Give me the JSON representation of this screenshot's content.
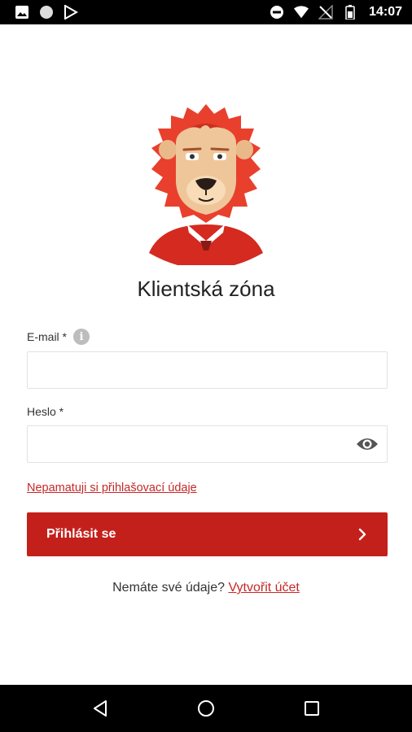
{
  "status_bar": {
    "time": "14:07",
    "left_icons": [
      "image-icon",
      "circle-icon",
      "play-store-icon"
    ],
    "right_icons": [
      "do-not-disturb-icon",
      "wifi-icon",
      "no-signal-icon",
      "battery-icon"
    ]
  },
  "header": {
    "title": "Klientská zóna",
    "mascot_icon": "lion-mascot"
  },
  "form": {
    "email_label": "E-mail *",
    "email_info_icon": "info-icon",
    "email_value": "",
    "email_placeholder": "",
    "password_label": "Heslo *",
    "password_value": "",
    "password_placeholder": "",
    "password_toggle_icon": "eye-icon",
    "forgot_link": "Nepamatuji si přihlašovací údaje",
    "login_button_label": "Přihlásit se",
    "login_button_icon": "chevron-right-icon"
  },
  "signup": {
    "prompt": "Nemáte své údaje?",
    "link": "Vytvořit účet"
  },
  "nav_bar": {
    "icons": [
      "back-icon",
      "home-icon",
      "recents-icon"
    ]
  },
  "colors": {
    "accent": "#c4201b",
    "link": "#c62828",
    "status_bar": "#000000",
    "nav_bar": "#000000"
  }
}
